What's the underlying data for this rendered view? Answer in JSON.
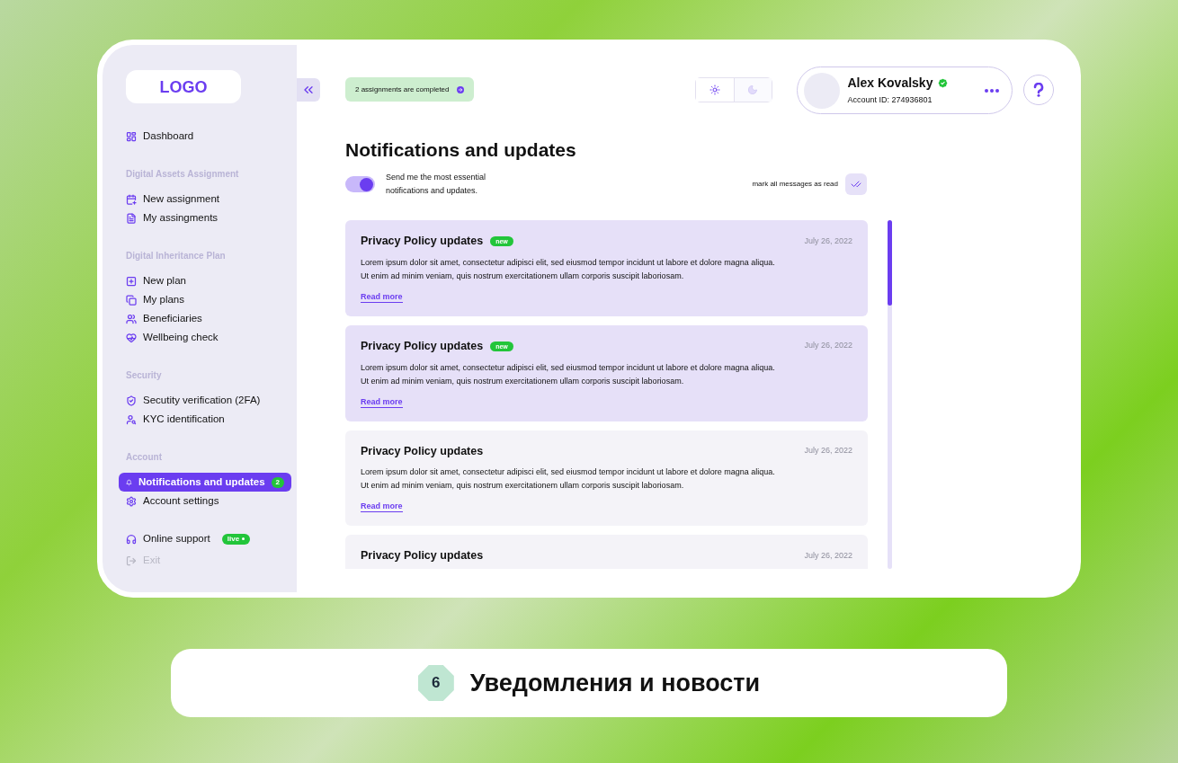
{
  "logo": "LOGO",
  "sidebar": {
    "sections": [
      {
        "items": [
          {
            "label": "Dashboard",
            "selected": false
          }
        ]
      },
      {
        "heading": "Digital Assets Assignment",
        "items": [
          {
            "label": "New assignment",
            "selected": false
          },
          {
            "label": "My assingments",
            "selected": false
          }
        ]
      },
      {
        "heading": "Digital Inheritance Plan",
        "items": [
          {
            "label": "New plan",
            "selected": false
          },
          {
            "label": "My plans",
            "selected": false
          },
          {
            "label": "Beneficiaries",
            "selected": false
          },
          {
            "label": "Wellbeing check",
            "selected": false
          }
        ]
      },
      {
        "heading": "Security",
        "items": [
          {
            "label": "Secutity verification (2FA)",
            "selected": false
          },
          {
            "label": "KYC identification",
            "selected": false
          }
        ]
      },
      {
        "heading": "Account",
        "items": [
          {
            "label": "Notifications and updates",
            "selected": true,
            "badge": "2"
          },
          {
            "label": "Account settings",
            "selected": false
          }
        ]
      }
    ],
    "footer": [
      {
        "label": "Online support",
        "badge": "live",
        "disabled": false
      },
      {
        "label": "Exit",
        "disabled": true
      }
    ]
  },
  "header": {
    "status": "2 assignments are completed",
    "theme": [
      {
        "kind": "light",
        "selected": true
      },
      {
        "kind": "dark",
        "selected": false
      }
    ],
    "user": {
      "name": "Alex Kovalsky",
      "verified": true,
      "account": "Account ID: 274936801"
    }
  },
  "page": {
    "title": "Notifications and updates",
    "toggle": {
      "on": true,
      "label": "Send me the most essential notifications and updates."
    },
    "mark_all": "mark all messages as read"
  },
  "notifications": [
    {
      "title": "Privacy Policy updates",
      "unread": true,
      "badge": "new",
      "date": "July 26, 2022",
      "body": [
        "Lorem ipsum dolor sit amet, consectetur adipisci elit, sed eiusmod tempor incidunt ut labore et dolore magna aliqua.",
        "Ut enim ad minim veniam, quis nostrum exercitationem ullam corporis suscipit laboriosam."
      ],
      "link": "Read more"
    },
    {
      "title": "Privacy Policy updates",
      "unread": true,
      "badge": "new",
      "date": "July 26, 2022",
      "body": [
        "Lorem ipsum dolor sit amet, consectetur adipisci elit, sed eiusmod tempor incidunt ut labore et dolore magna aliqua.",
        "Ut enim ad minim veniam, quis nostrum exercitationem ullam corporis suscipit laboriosam."
      ],
      "link": "Read more"
    },
    {
      "title": "Privacy Policy updates",
      "unread": false,
      "date": "July 26, 2022",
      "body": [
        "Lorem ipsum dolor sit amet, consectetur adipisci elit, sed eiusmod tempor incidunt ut labore et dolore magna aliqua.",
        "Ut enim ad minim veniam, quis nostrum exercitationem ullam corporis suscipit laboriosam."
      ],
      "link": "Read more"
    },
    {
      "title": "Privacy Policy updates",
      "unread": false,
      "date": "July 26, 2022"
    }
  ],
  "caption": {
    "number": "6",
    "text": "Уведомления и новости"
  }
}
